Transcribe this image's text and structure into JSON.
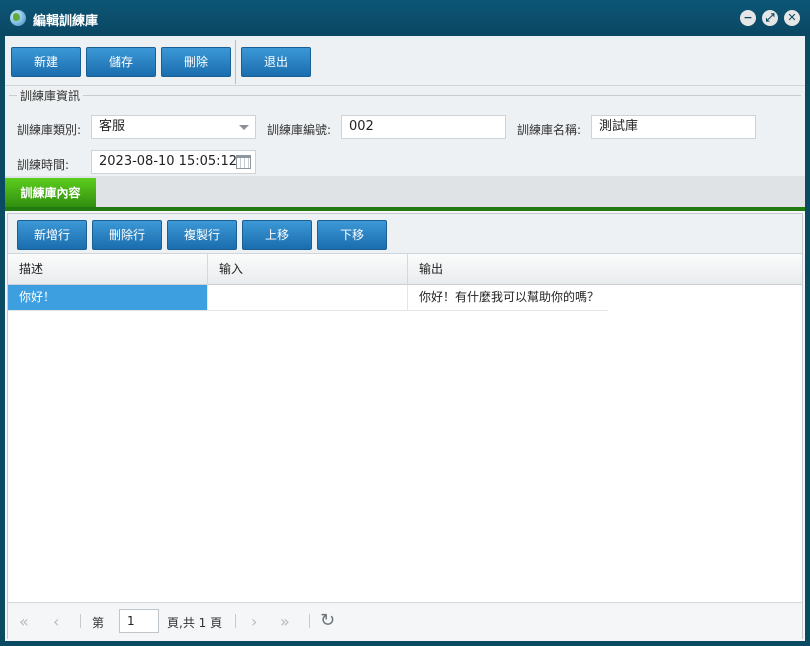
{
  "window": {
    "title": "編輯訓練庫",
    "controls": {
      "minimize": "−",
      "maximize": "⤢",
      "close": "✕"
    }
  },
  "toolbar": {
    "new_label": "新建",
    "save_label": "儲存",
    "delete_label": "刪除",
    "exit_label": "退出"
  },
  "info": {
    "legend": "訓練庫資訊",
    "category_label": "訓練庫類別:",
    "category_value": "客服",
    "number_label": "訓練庫編號:",
    "number_value": "002",
    "name_label": "訓練庫名稱:",
    "name_value": "測試庫",
    "time_label": "訓練時間:",
    "time_value": "2023-08-10 15:05:12"
  },
  "tabs": [
    {
      "label": "訓練庫內容",
      "active": true
    }
  ],
  "grid_toolbar": {
    "add_row": "新增行",
    "delete_row": "刪除行",
    "copy_row": "複製行",
    "move_up": "上移",
    "move_down": "下移"
  },
  "grid": {
    "columns": [
      "描述",
      "输入",
      "输出"
    ],
    "rows": [
      {
        "desc": "你好！",
        "input": "",
        "output": "你好！有什麼我可以幫助你的嗎？"
      }
    ]
  },
  "pager": {
    "page_prefix": "第",
    "page_value": "1",
    "page_suffix": "頁,共 1 頁",
    "first_icon": "«",
    "prev_icon": "‹",
    "next_icon": "›",
    "last_icon": "»",
    "refresh_icon": "↻"
  },
  "colors": {
    "titlebar": "#0a4a63",
    "button": "#2a82c4",
    "tab_active": "#3fa414",
    "selection": "#3d9ee0"
  }
}
